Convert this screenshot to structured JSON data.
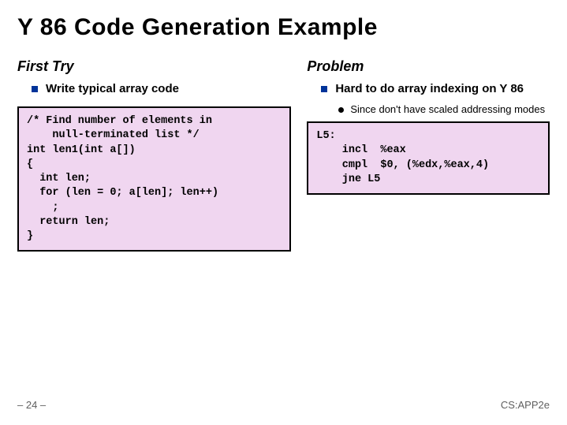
{
  "title": "Y 86 Code Generation Example",
  "left": {
    "heading": "First Try",
    "bullet": "Write typical array code",
    "code": "/* Find number of elements in\n    null-terminated list */\nint len1(int a[])\n{\n  int len;\n  for (len = 0; a[len]; len++)\n    ;\n  return len;\n}"
  },
  "right": {
    "heading": "Problem",
    "bullet": "Hard to do array indexing on Y 86",
    "sub_bullet": "Since don't have scaled addressing modes",
    "code": "L5:\n    incl  %eax\n    cmpl  $0, (%edx,%eax,4)\n    jne L5"
  },
  "footer": {
    "page": "– 24 –",
    "course": "CS:APP2e"
  }
}
